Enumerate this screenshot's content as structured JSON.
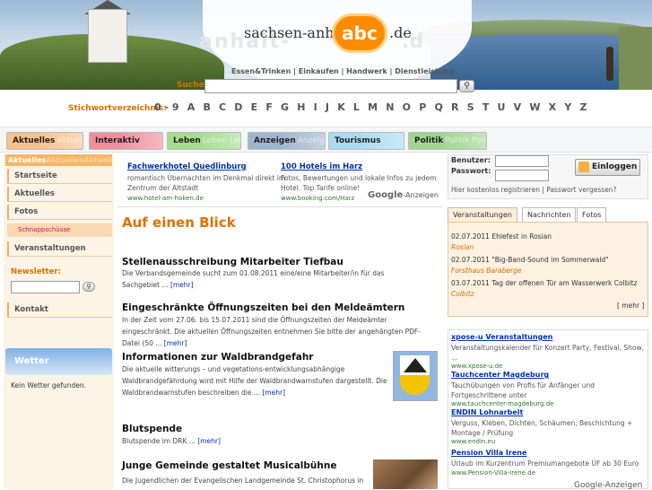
{
  "header": {
    "logo_prefix": "sachsen-anhalt-",
    "logo_abc": "abc",
    "logo_tld": ".de",
    "watermark_left": "anhalt-",
    "watermark_right": ".d",
    "category_links": "Essen&Trinken | Einkaufen | Handwerk | Dienstleistung",
    "search_label": "Suche:",
    "search_value": "",
    "search_button_icon": "search-icon",
    "stichwort_label": "Stichwortverzeichnis:",
    "alphabet": [
      "0 - 9",
      "A",
      "B",
      "C",
      "D",
      "E",
      "F",
      "G",
      "H",
      "I",
      "J",
      "K",
      "L",
      "M",
      "N",
      "O",
      "P",
      "Q",
      "R",
      "S",
      "T",
      "U",
      "V",
      "W",
      "X",
      "Y",
      "Z"
    ]
  },
  "nav": {
    "tabs": [
      {
        "label": "Aktuelles",
        "ghost": "Aktuelles",
        "color": "#f5c28c"
      },
      {
        "label": "Interaktiv",
        "ghost": "",
        "color": "#f08f9c"
      },
      {
        "label": "Leben",
        "ghost": "Leben Leben",
        "color": "#a4dd8d"
      },
      {
        "label": "Anzeigen",
        "ghost": "Anzeigen",
        "color": "#9fb5cf"
      },
      {
        "label": "Tourismus",
        "ghost": "",
        "color": "#a9dcf0"
      },
      {
        "label": "Politik",
        "ghost": "Politik Politik",
        "color": "#9fd58f"
      }
    ]
  },
  "sidebar": {
    "header": "Aktuelles",
    "header_faded": "AktuellesAktuelles",
    "items": [
      "Startseite",
      "Aktuelles",
      "Fotos"
    ],
    "sub_item": "Schnappschüsse",
    "veranstaltungen": "Veranstaltungen",
    "newsletter_label": "Newsletter:",
    "newsletter_value": "",
    "kontakt": "Kontakt",
    "wetter_label": "Wetter",
    "wetter_text": "Kein Wetter gefunden."
  },
  "ads_top": [
    {
      "title": "Fachwerkhotel Quedlinburg",
      "text1": "romantisch Übernachten im Denkmal direkt im",
      "text2": "Zentrum der Altstadt",
      "url": "www.hotel-am-hoken.de"
    },
    {
      "title": "100 Hotels im Harz",
      "text1": "Fotos, Bewertungen und lokale Infos zu jedem",
      "text2": "Hotel. Top Tarife online!",
      "url": "www.booking.com/Harz"
    }
  ],
  "google_ads_label": "Google",
  "google_ads_suffix": "-Anzeigen",
  "main": {
    "heading": "Auf einen Blick",
    "more_label": "[mehr]",
    "articles": [
      {
        "title": "Stellenausschreibung Mitarbeiter Tiefbau",
        "text": "Die Verbandsgemeinde sucht zum 01.08.2011 eine/eine Mitarbeiter/in für das Sachgebiet ..."
      },
      {
        "title": "Eingeschränkte Öffnungszeiten bei den Meldeämtern",
        "text": "In der Zeit vom 27.06. bis 15.07.2011 sind die Öffnungszeiten der Meldeämter eingeschränkt. Die aktuellen Öffnungszeiten entnehmen Sie bitte der angehängten PDF-Datei (50 ..."
      },
      {
        "title": "Informationen zur Waldbrandgefahr",
        "text": "Die aktuelle witterungs – und vegetations-entwicklungsabhängige Waldbrandgefährdung wird mit Hilfe der Waldbrandwarnstufen dargestellt. Die Waldbrandwarnstufen beschreiben die ..."
      },
      {
        "title": "Blutspende",
        "text": "Blutspende im DRK ..."
      },
      {
        "title": "Junge Gemeinde gestaltet Musicalbühne",
        "text": "Die Jugendlichen der Evangelischen Landgemeinde St. Christophorus in"
      }
    ]
  },
  "login": {
    "user_label": "Benutzer:",
    "pass_label": "Passwort:",
    "user_value": "",
    "pass_value": "",
    "button": "Einloggen",
    "register": "Hier kostenlos registrieren",
    "separator": "|",
    "forgot": "Passwort vergessen?"
  },
  "right_tabs": [
    "Veranstaltungen",
    "Nachrichten",
    "Fotos"
  ],
  "events": [
    {
      "date_title": "02.07.2011 Ehlefest in Rosian",
      "place": "Rosian"
    },
    {
      "date_title": "02.07.2011 \"Big-Band-Sound im Sommerwald\"",
      "place": "Forsthaus Baraberge"
    },
    {
      "date_title": "03.07.2011 Tag der offenen Tür am Wasserwerk Colbitz",
      "place": "Colbitz"
    }
  ],
  "events_more": "[ mehr ]",
  "sponsored": [
    {
      "title": "xpose-u Veranstaltungen",
      "text": "Veranstaltungskalender für Konzert Party, Festival, Show, ...",
      "url": "www.xpose-u.de"
    },
    {
      "title": "Tauchcenter Magdeburg",
      "text": "Tauchübungen von Profis für Anfänger und Fortgeschrittene unter",
      "url": "www.tauchcenter-magdeburg.de"
    },
    {
      "title": "ENDIN Lohnarbeit",
      "text": "Verguss, Kleben, Dichten, Schäumen, Beschichtung + Montage / Prüfung",
      "url": "www.endin.eu"
    },
    {
      "title": "Pension Villa Irene",
      "text": "Urlaub im Kurzentrum Premiumangebote ÜF ab 30 Euro",
      "url": "www.Pension-Villa-Irene.de"
    }
  ],
  "google_footer": "Google-Anzeigen"
}
